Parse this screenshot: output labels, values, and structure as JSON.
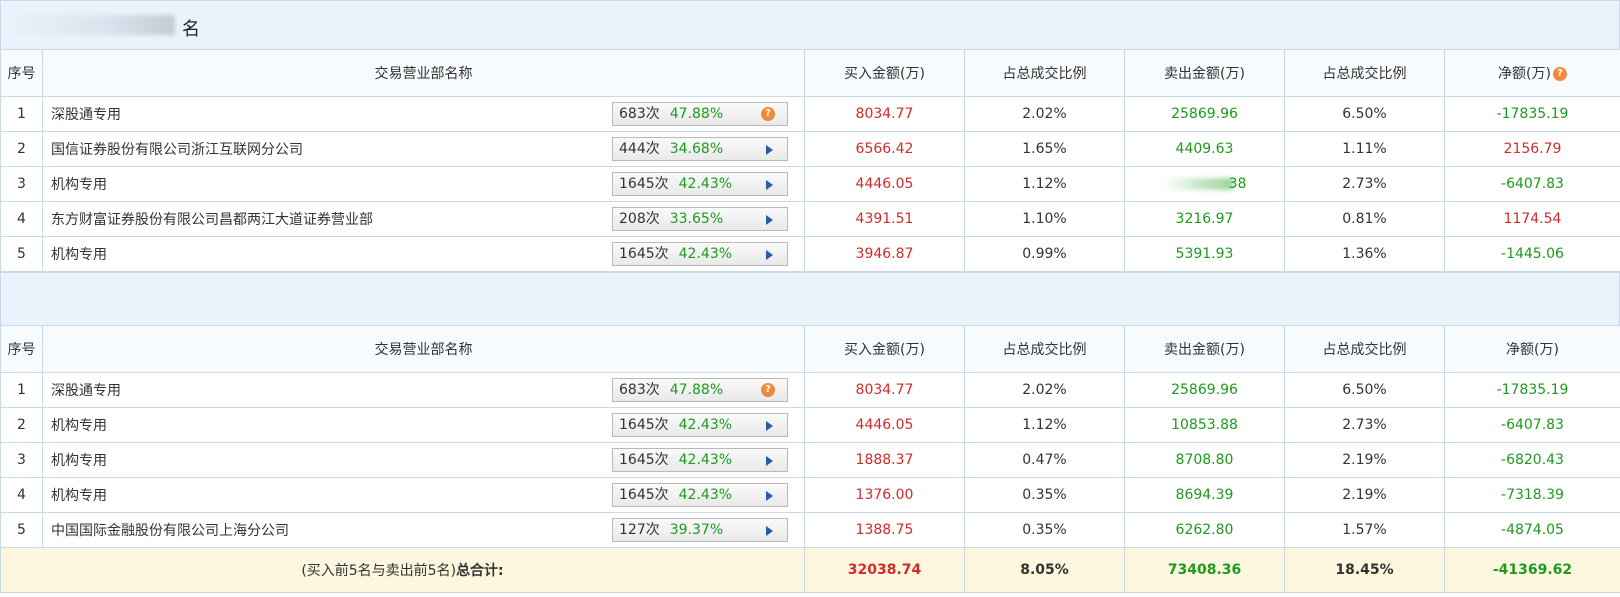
{
  "table1": {
    "title": "名",
    "headers": [
      "序号",
      "交易营业部名称",
      "买入金额(万)",
      "占总成交比例",
      "卖出金额(万)",
      "占总成交比例",
      "净额(万)"
    ],
    "rows": [
      {
        "idx": "1",
        "name": "深股通专用",
        "times": "683次",
        "pct": "47.88%",
        "icon": "question-icon",
        "buy": "8034.77",
        "buy_ratio": "2.02%",
        "sell": "25869.96",
        "sell_ratio": "6.50%",
        "net": "-17835.19",
        "net_color": "green"
      },
      {
        "idx": "2",
        "name": "国信证券股份有限公司浙江互联网分公司",
        "times": "444次",
        "pct": "34.68%",
        "icon": "play-arrow-icon",
        "buy": "6566.42",
        "buy_ratio": "1.65%",
        "sell": "4409.63",
        "sell_ratio": "1.11%",
        "net": "2156.79",
        "net_color": "red"
      },
      {
        "idx": "3",
        "name": "机构专用",
        "times": "1645次",
        "pct": "42.43%",
        "icon": "play-arrow-icon",
        "buy": "4446.05",
        "buy_ratio": "1.12%",
        "sell": "38",
        "sell_ratio": "2.73%",
        "net": "-6407.83",
        "net_color": "green"
      },
      {
        "idx": "4",
        "name": "东方财富证券股份有限公司昌都两江大道证券营业部",
        "times": "208次",
        "pct": "33.65%",
        "icon": "play-arrow-icon",
        "buy": "4391.51",
        "buy_ratio": "1.10%",
        "sell": "3216.97",
        "sell_ratio": "0.81%",
        "net": "1174.54",
        "net_color": "red"
      },
      {
        "idx": "5",
        "name": "机构专用",
        "times": "1645次",
        "pct": "42.43%",
        "icon": "play-arrow-icon",
        "buy": "3946.87",
        "buy_ratio": "0.99%",
        "sell": "5391.93",
        "sell_ratio": "1.36%",
        "net": "-1445.06",
        "net_color": "green"
      }
    ]
  },
  "table2": {
    "headers": [
      "序号",
      "交易营业部名称",
      "买入金额(万)",
      "占总成交比例",
      "卖出金额(万)",
      "占总成交比例",
      "净额(万)"
    ],
    "rows": [
      {
        "idx": "1",
        "name": "深股通专用",
        "times": "683次",
        "pct": "47.88%",
        "icon": "question-icon",
        "buy": "8034.77",
        "buy_ratio": "2.02%",
        "sell": "25869.96",
        "sell_ratio": "6.50%",
        "net": "-17835.19",
        "net_color": "green"
      },
      {
        "idx": "2",
        "name": "机构专用",
        "times": "1645次",
        "pct": "42.43%",
        "icon": "play-arrow-icon",
        "buy": "4446.05",
        "buy_ratio": "1.12%",
        "sell": "10853.88",
        "sell_ratio": "2.73%",
        "net": "-6407.83",
        "net_color": "green"
      },
      {
        "idx": "3",
        "name": "机构专用",
        "times": "1645次",
        "pct": "42.43%",
        "icon": "play-arrow-icon",
        "buy": "1888.37",
        "buy_ratio": "0.47%",
        "sell": "8708.80",
        "sell_ratio": "2.19%",
        "net": "-6820.43",
        "net_color": "green"
      },
      {
        "idx": "4",
        "name": "机构专用",
        "times": "1645次",
        "pct": "42.43%",
        "icon": "play-arrow-icon",
        "buy": "1376.00",
        "buy_ratio": "0.35%",
        "sell": "8694.39",
        "sell_ratio": "2.19%",
        "net": "-7318.39",
        "net_color": "green"
      },
      {
        "idx": "5",
        "name": "中国国际金融股份有限公司上海分公司",
        "times": "127次",
        "pct": "39.37%",
        "icon": "play-arrow-icon",
        "buy": "1388.75",
        "buy_ratio": "0.35%",
        "sell": "6262.80",
        "sell_ratio": "1.57%",
        "net": "-4874.05",
        "net_color": "green"
      }
    ],
    "total": {
      "label_prefix": "(买入前5名与卖出前5名)",
      "label_suffix": "总合计:",
      "buy": "32038.74",
      "buy_ratio": "8.05%",
      "sell": "73408.36",
      "sell_ratio": "18.45%",
      "net": "-41369.62"
    }
  },
  "question_mark": "?",
  "colors": {
    "red": "#d22b2b",
    "green": "#1e9a1e",
    "header_bg": "#eaf3fb",
    "total_bg": "#fcf7de"
  }
}
